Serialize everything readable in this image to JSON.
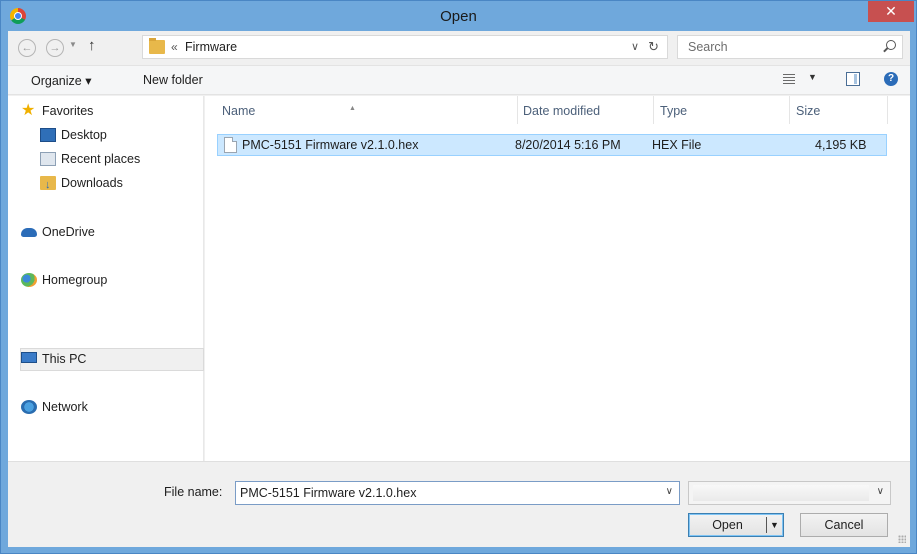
{
  "window": {
    "title": "Open",
    "close_glyph": "✕"
  },
  "address": {
    "chevron": "«",
    "path": "Firmware",
    "search_placeholder": "Search"
  },
  "toolbar": {
    "organize": "Organize ▾",
    "new_folder": "New folder",
    "help_glyph": "?"
  },
  "nav": {
    "items": [
      {
        "label": "Favorites",
        "icon": "star-icon"
      },
      {
        "label": "Desktop",
        "icon": "desktop-icon"
      },
      {
        "label": "Recent places",
        "icon": "recent-places-icon"
      },
      {
        "label": "Downloads",
        "icon": "downloads-icon"
      },
      {
        "label": "OneDrive",
        "icon": "onedrive-icon"
      },
      {
        "label": "Homegroup",
        "icon": "homegroup-icon"
      },
      {
        "label": "This PC",
        "icon": "computer-icon",
        "selected": true
      },
      {
        "label": "Network",
        "icon": "network-icon"
      }
    ]
  },
  "files": {
    "columns": [
      "Name",
      "Date modified",
      "Type",
      "Size"
    ],
    "rows": [
      {
        "name": "PMC-5151 Firmware v2.1.0.hex",
        "date": "8/20/2014 5:16 PM",
        "type": "HEX File",
        "size": "4,195 KB",
        "selected": true
      }
    ]
  },
  "bottom": {
    "file_name_label": "File name:",
    "file_name_value": "PMC-5151 Firmware v2.1.0.hex",
    "open_label": "Open",
    "cancel_label": "Cancel"
  },
  "colors": {
    "title_bar": "#6fa8dc",
    "close": "#c75050",
    "selection": "#cce8ff",
    "selection_border": "#99d1ff"
  }
}
